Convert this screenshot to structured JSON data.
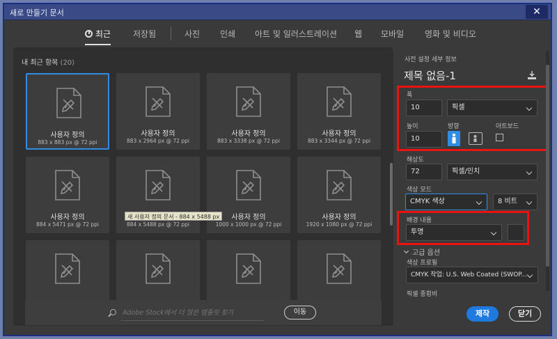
{
  "window": {
    "title": "새로 만들기 문서",
    "close_glyph": "✕"
  },
  "tabs": [
    {
      "label": "최근",
      "active": true
    },
    {
      "label": "저장됨"
    },
    {
      "label": "사진"
    },
    {
      "label": "인쇄"
    },
    {
      "label": "아트 및 일러스트레이션"
    },
    {
      "label": "웹"
    },
    {
      "label": "모바일"
    },
    {
      "label": "영화 및 비디오"
    }
  ],
  "recent": {
    "title": "내 최근 항목",
    "count": "(20)",
    "items": [
      {
        "name": "사용자 정의",
        "dims": "883 x 883 px @ 72 ppi"
      },
      {
        "name": "사용자 정의",
        "dims": "883 x 2964 px @ 72 ppi"
      },
      {
        "name": "사용자 정의",
        "dims": "883 x 3338 px @ 72 ppi"
      },
      {
        "name": "사용자 정의",
        "dims": "883 x 3344 px @ 72 ppi"
      },
      {
        "name": "사용자 정의",
        "dims": "884 x 5471 px @ 72 ppi"
      },
      {
        "name": "사용자 정의",
        "dims": "884 x 5488 px @ 72 ppi"
      },
      {
        "name": "사용자 정의",
        "dims": "1000 x 1000 px @ 72 ppi"
      },
      {
        "name": "사용자 정의",
        "dims": "1920 x 1080 px @ 72 ppi"
      },
      {
        "name": "",
        "dims": ""
      },
      {
        "name": "",
        "dims": ""
      },
      {
        "name": "",
        "dims": ""
      },
      {
        "name": "",
        "dims": ""
      }
    ],
    "tooltip": "새 사용자 정의 문서 - 884 x 5488 px"
  },
  "search": {
    "placeholder": "Adobe Stock에서 더 많은 템플릿 찾기",
    "go_label": "이동"
  },
  "details": {
    "header": "사전 설정 세부 정보",
    "doc_name": "제목 없음-1",
    "width_label": "폭",
    "width_value": "10",
    "unit": "픽셀",
    "height_label": "높이",
    "height_value": "10",
    "orientation_label": "방향",
    "artboard_label": "아트보드",
    "resolution_label": "해상도",
    "resolution_value": "72",
    "resolution_unit": "픽셀/인치",
    "color_mode_label": "색상 모드",
    "color_mode": "CMYK 색상",
    "bit_depth": "8 비트",
    "background_label": "배경 내용",
    "background": "투명",
    "advanced_label": "고급 옵션",
    "color_profile_label": "색상 프로필",
    "color_profile": "CMYK 작업: U.S. Web Coated (SWOP...",
    "pixel_ratio_label": "픽셀 종횡비"
  },
  "buttons": {
    "create": "제작",
    "close": "닫기"
  },
  "colors": {
    "accent": "#2f8de4",
    "highlight": "#ee1111",
    "background_swatch": "#2c2c2c"
  }
}
